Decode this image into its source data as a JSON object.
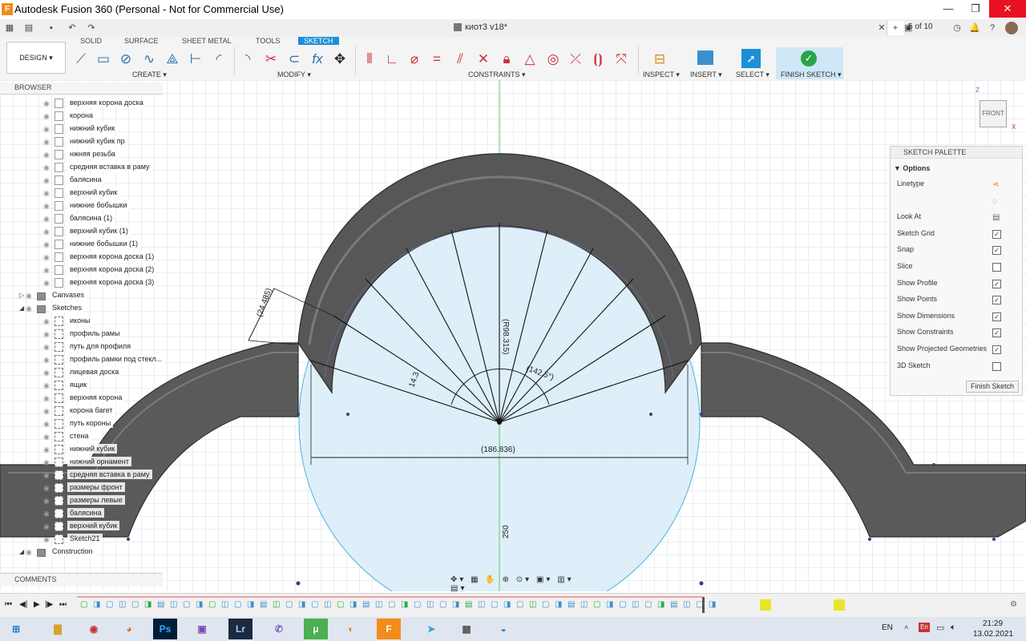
{
  "window": {
    "app_icon": "F",
    "title": "Autodesk Fusion 360 (Personal - Not for Commercial Use)",
    "minimize_icon": "minimize-icon",
    "restore_icon": "restore-icon",
    "close_icon": "close-icon"
  },
  "doc_bar": {
    "document_title": "киот3 v18*",
    "page_count": "5 of 10"
  },
  "toolbar": {
    "workspace": "DESIGN ▾",
    "tabs": [
      "SOLID",
      "SURFACE",
      "SHEET METAL",
      "TOOLS",
      "SKETCH"
    ],
    "active_tab": "SKETCH",
    "groups": {
      "create": "CREATE ▾",
      "modify": "MODIFY ▾",
      "constraints": "CONSTRAINTS ▾",
      "inspect": "INSPECT ▾",
      "insert": "INSERT ▾",
      "select": "SELECT ▾",
      "finish": "FINISH SKETCH ▾"
    }
  },
  "browser": {
    "title": "BROWSER",
    "items": [
      {
        "label": "верхняя корона доска",
        "type": "body"
      },
      {
        "label": "корона",
        "type": "body"
      },
      {
        "label": "нижний кубик",
        "type": "body"
      },
      {
        "label": "нижний кубик пр",
        "type": "body"
      },
      {
        "label": "нжняя резьба",
        "type": "body"
      },
      {
        "label": "средняя вставка в раму",
        "type": "body"
      },
      {
        "label": "балясина",
        "type": "body"
      },
      {
        "label": "верхний кубик",
        "type": "body"
      },
      {
        "label": "нижние бобышки",
        "type": "body"
      },
      {
        "label": "балясина (1)",
        "type": "body"
      },
      {
        "label": "верхний кубик (1)",
        "type": "body"
      },
      {
        "label": "нижние бобышки (1)",
        "type": "body"
      },
      {
        "label": "верхняя корона доска (1)",
        "type": "body"
      },
      {
        "label": "верхняя корона доска (2)",
        "type": "body"
      },
      {
        "label": "верхняя корона доска (3)",
        "type": "body"
      },
      {
        "label": "Canvases",
        "type": "folder"
      },
      {
        "label": "Sketches",
        "type": "folder"
      },
      {
        "label": "иконы",
        "type": "sketch"
      },
      {
        "label": "профиль рамы",
        "type": "sketch"
      },
      {
        "label": "путь для профиля",
        "type": "sketch"
      },
      {
        "label": "профиль рамки под стекл...",
        "type": "sketch"
      },
      {
        "label": "лицевая доска",
        "type": "sketch"
      },
      {
        "label": "ящик",
        "type": "sketch"
      },
      {
        "label": "верхняя корона",
        "type": "sketch"
      },
      {
        "label": "корона багет",
        "type": "sketch"
      },
      {
        "label": "путь короны",
        "type": "sketch"
      },
      {
        "label": "стена",
        "type": "sketch"
      },
      {
        "label": "нижний кубик",
        "type": "sketch"
      },
      {
        "label": "нижний орнамент",
        "type": "sketch"
      },
      {
        "label": "средняя вставка в раму",
        "type": "sketch"
      },
      {
        "label": "размеры фронт",
        "type": "sketch"
      },
      {
        "label": "размеры левые",
        "type": "sketch"
      },
      {
        "label": "балясина",
        "type": "sketch"
      },
      {
        "label": "верхний кубик",
        "type": "sketch"
      },
      {
        "label": "Sketch21",
        "type": "sketch"
      },
      {
        "label": "Construction",
        "type": "folder"
      }
    ],
    "comments": "COMMENTS"
  },
  "canvas": {
    "dimensions": [
      "(24.485)",
      "(R98.315)",
      "(142.5°)",
      "14.3",
      "(186.836)",
      "250"
    ],
    "viewcube": {
      "z": "Z",
      "face": "FRONT",
      "x": "X"
    }
  },
  "sketch_palette": {
    "title": "SKETCH PALETTE",
    "section": "▼ Options",
    "rows": [
      {
        "label": "Linetype",
        "control": "icon"
      },
      {
        "label": "",
        "control": "icon"
      },
      {
        "label": "Look At",
        "control": "icon"
      },
      {
        "label": "Sketch Grid",
        "checked": true
      },
      {
        "label": "Snap",
        "checked": true
      },
      {
        "label": "Slice",
        "checked": false
      },
      {
        "label": "Show Profile",
        "checked": true
      },
      {
        "label": "Show Points",
        "checked": true
      },
      {
        "label": "Show Dimensions",
        "checked": true
      },
      {
        "label": "Show Constraints",
        "checked": true
      },
      {
        "label": "Show Projected Geometries",
        "checked": true
      },
      {
        "label": "3D Sketch",
        "checked": false
      }
    ],
    "finish_button": "Finish Sketch"
  },
  "taskbar": {
    "language": "EN",
    "lang_badge": "En",
    "time": "21:29",
    "date": "13.02.2021",
    "apps": [
      "start",
      "explorer",
      "camera",
      "firefox",
      "photoshop",
      "save",
      "lightroom",
      "viber",
      "utorrent",
      "blender",
      "fusion",
      "telegram",
      "calculator",
      "edge"
    ]
  },
  "colors": {
    "accent": "#1d8fd8",
    "sketch_fill": "#d8ecf8",
    "body_dark": "#555555",
    "finish_green": "#26a645"
  }
}
